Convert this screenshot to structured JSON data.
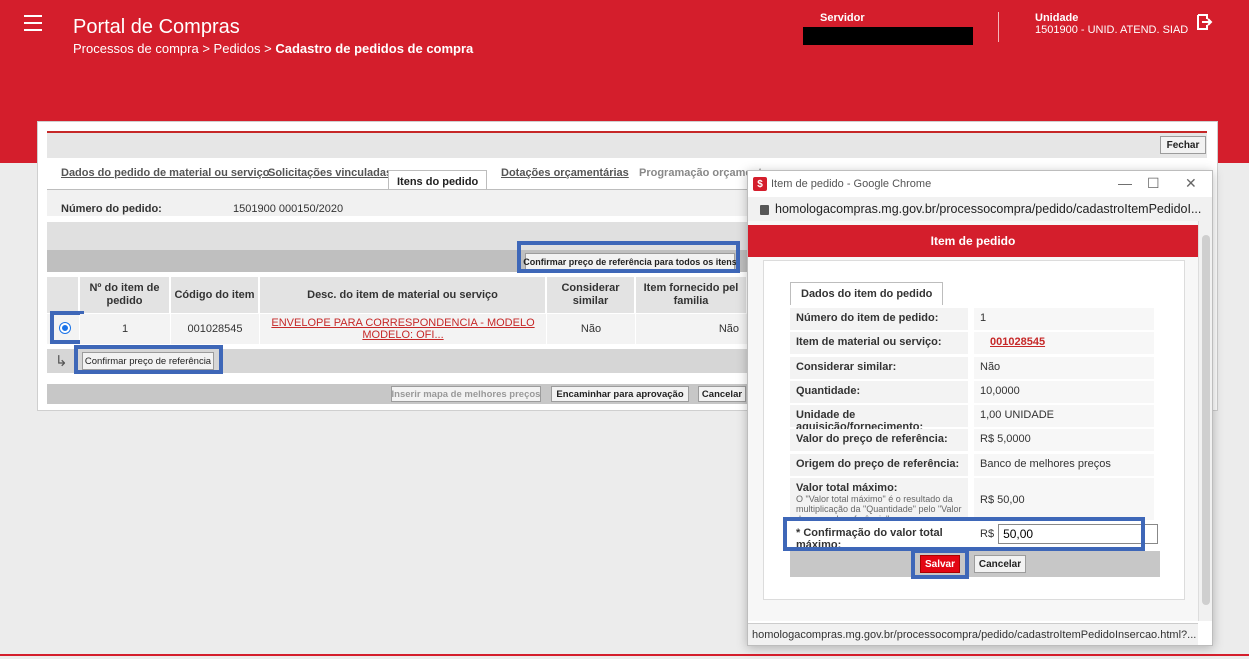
{
  "header": {
    "app_title": "Portal de Compras",
    "breadcrumb_path": "Processos de compra > Pedidos > ",
    "breadcrumb_current": "Cadastro de pedidos de compra",
    "servidor_label": "Servidor",
    "unidade_label": "Unidade",
    "unidade_value": "1501900 - UNID. ATEND. SIAD"
  },
  "panel": {
    "close_label": "Fechar",
    "tabs": [
      "Dados do pedido de material ou serviço",
      "Solicitações vinculadas",
      "Itens do pedido",
      "Dotações orçamentárias",
      "Programação orçament"
    ],
    "pedido_label": "Número do pedido:",
    "pedido_value": "1501900 000150/2020",
    "confirm_all_label": "Confirmar preço de referência para todos os itens",
    "table": {
      "headers": [
        "Nº do item de pedido",
        "Código do item",
        "Desc. do item de material ou serviço",
        "Considerar similar",
        "Item fornecido pel familia"
      ],
      "rows": [
        {
          "item": "1",
          "codigo": "001028545",
          "desc": "ENVELOPE PARA CORRESPONDENCIA - MODELO MODELO: OFI...",
          "similar": "Não",
          "fornecido": "Não"
        }
      ]
    },
    "confirm_ref_label": "Confirmar preço de referência",
    "inserir_label": "Inserir mapa de melhores preços",
    "encaminhar_label": "Encaminhar para aprovação",
    "cancelar_label": "Cancelar"
  },
  "popup": {
    "window_title": "Item de pedido - Google Chrome",
    "url": "homologacompras.mg.gov.br/processocompra/pedido/cadastroItemPedidoI...",
    "header": "Item de pedido",
    "tab": "Dados do item do pedido",
    "fields": [
      {
        "label": "Número do item de pedido:",
        "value": "1"
      },
      {
        "label": "Item de material ou serviço:",
        "value": "001028545"
      },
      {
        "label": "Considerar similar:",
        "value": "Não"
      },
      {
        "label": "Quantidade:",
        "value": "10,0000"
      },
      {
        "label": "Unidade de aquisição/fornecimento:",
        "value": "1,00 UNIDADE"
      },
      {
        "label": "Valor do preço de referência:",
        "value": "R$ 5,0000"
      },
      {
        "label": "Origem do preço de referência:",
        "value": "Banco de melhores preços"
      },
      {
        "label": "Valor total máximo:",
        "note": "O \"Valor total máximo\" é o resultado da multiplicação da \"Quantidade\" pelo \"Valor do preço de referência\".",
        "value": "R$ 50,00"
      }
    ],
    "confirm_label": "* Confirmação do valor total máximo:",
    "confirm_prefix": "R$",
    "confirm_value": "50,00",
    "save_label": "Salvar",
    "cancel_label": "Cancelar",
    "status_url": "homologacompras.mg.gov.br/processocompra/pedido/cadastroItemPedidoInsercao.html?..."
  },
  "colors": {
    "brand_red": "#d41e2c",
    "highlight_blue": "#3e67b8",
    "link_red": "#c62828"
  }
}
